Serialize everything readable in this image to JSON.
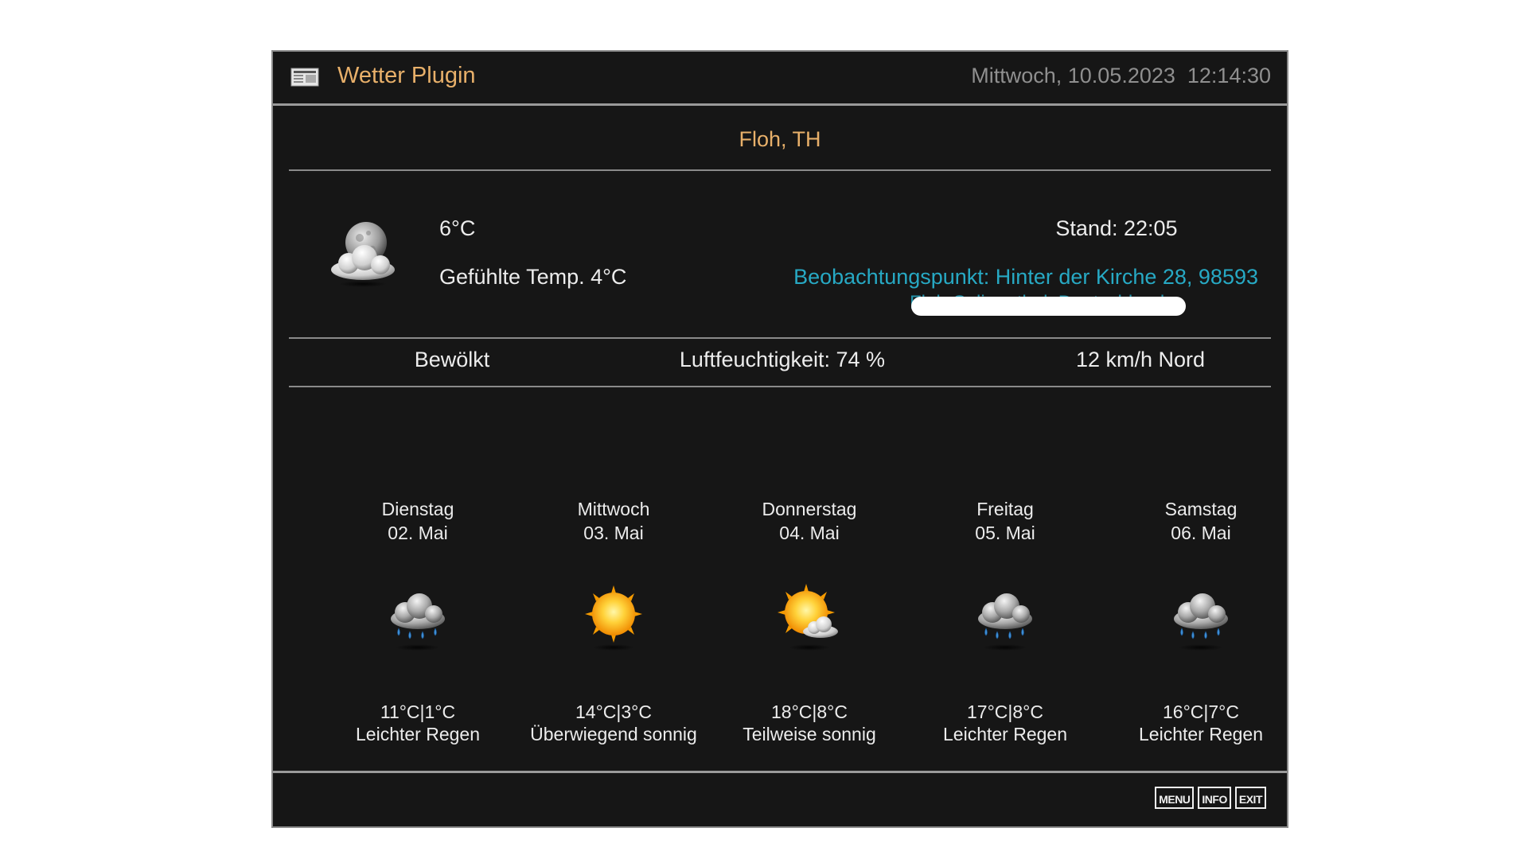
{
  "header": {
    "title": "Wetter Plugin",
    "datetime": "Mittwoch, 10.05.2023  12:14:30",
    "icon": "newspaper-icon"
  },
  "location": "Floh, TH",
  "current": {
    "icon": "moon-cloud-icon",
    "temperature": "6°C",
    "feels_like": "Gefühlte Temp. 4°C",
    "stand": "Stand: 22:05",
    "observation": "Beobachtungspunkt: Hinter der Kirche 28, 98593",
    "observation_line2": "Floh-Seligenthal, Deutschland"
  },
  "conditions": {
    "sky": "Bewölkt",
    "humidity": "Luftfeuchtigkeit: 74 %",
    "wind": "12 km/h Nord"
  },
  "forecast": [
    {
      "day": "Dienstag",
      "date": "02. Mai",
      "temps": "11°C|1°C",
      "desc": "Leichter Regen",
      "icon": "rain-cloud-icon"
    },
    {
      "day": "Mittwoch",
      "date": "03. Mai",
      "temps": "14°C|3°C",
      "desc": "Überwiegend sonnig",
      "icon": "sun-icon"
    },
    {
      "day": "Donnerstag",
      "date": "04. Mai",
      "temps": "18°C|8°C",
      "desc": "Teilweise sonnig",
      "icon": "sun-cloud-icon"
    },
    {
      "day": "Freitag",
      "date": "05. Mai",
      "temps": "17°C|8°C",
      "desc": "Leichter Regen",
      "icon": "rain-cloud-icon"
    },
    {
      "day": "Samstag",
      "date": "06. Mai",
      "temps": "16°C|7°C",
      "desc": "Leichter Regen",
      "icon": "rain-cloud-icon"
    }
  ],
  "footer": {
    "keys": [
      "MENU",
      "INFO",
      "EXIT"
    ]
  },
  "colors": {
    "background": "#161616",
    "accent": "#e8b06a",
    "link": "#27a9c4",
    "text": "#ececec",
    "muted": "#8f8f8f"
  }
}
